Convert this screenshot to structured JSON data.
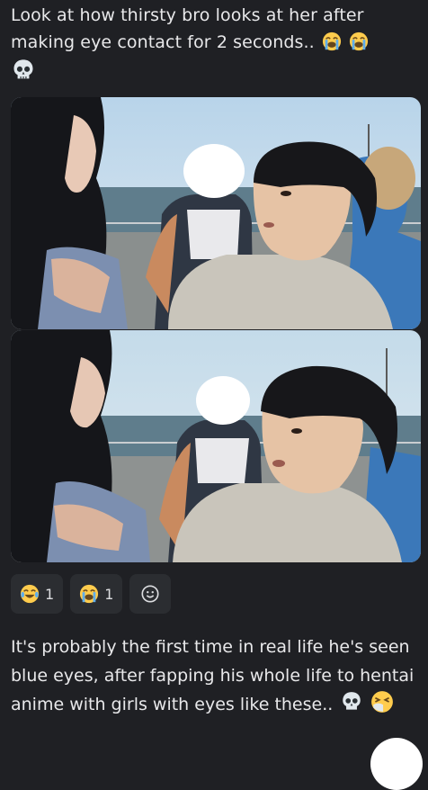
{
  "post": {
    "text": "Look at how thirsty bro looks at her after making eye contact for 2 seconds.."
  },
  "reactions": [
    {
      "emoji": "joy-tears-icon",
      "count": "1"
    },
    {
      "emoji": "loudly-crying-icon",
      "count": "1"
    }
  ],
  "reply": {
    "text": "It's probably the first time in real life he's seen blue eyes, after fapping his whole life to hentai anime with girls with eyes like these.."
  },
  "colors": {
    "background": "#1f2024",
    "reaction_bg": "#2b2d31",
    "text": "#e8e8ea"
  }
}
